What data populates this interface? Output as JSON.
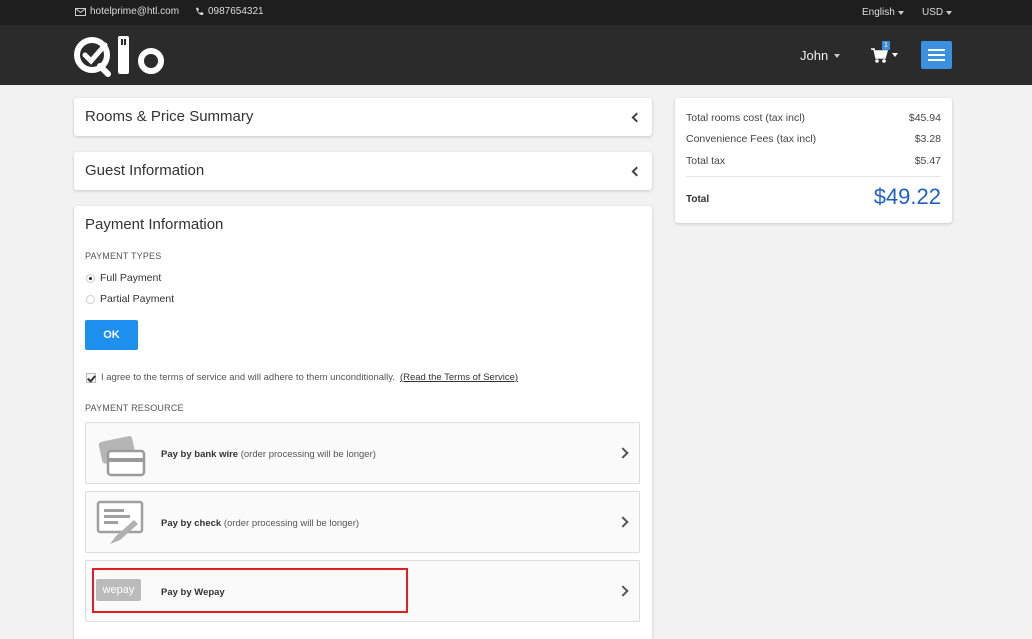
{
  "topbar": {
    "email": "hotelprime@htl.com",
    "phone": "0987654321",
    "language": "English",
    "currency": "USD"
  },
  "header": {
    "user": "John",
    "cart_count": "1"
  },
  "sections": {
    "rooms_title": "Rooms & Price Summary",
    "guest_title": "Guest Information",
    "payment_title": "Payment Information"
  },
  "payment": {
    "types_label": "PAYMENT TYPES",
    "full_payment": "Full Payment",
    "partial_payment": "Partial Payment",
    "ok_label": "OK",
    "agree_text": "I agree to the terms of service and will adhere to them unconditionally.",
    "terms_link": "(Read the Terms of Service)",
    "resource_label": "PAYMENT RESOURCE",
    "options": [
      {
        "method": "Pay by bank wire",
        "note": " (order processing will be longer)"
      },
      {
        "method": "Pay by check",
        "note": " (order processing will be longer)"
      },
      {
        "method": "Pay by Wepay",
        "note": ""
      }
    ],
    "wepay_logo": "wepay"
  },
  "summary": {
    "rooms_cost_label": "Total rooms cost (tax incl)",
    "rooms_cost": "$45.94",
    "fees_label": "Convenience Fees (tax incl)",
    "fees": "$3.28",
    "tax_label": "Total tax",
    "tax": "$5.47",
    "total_label": "Total",
    "total": "$49.22"
  }
}
